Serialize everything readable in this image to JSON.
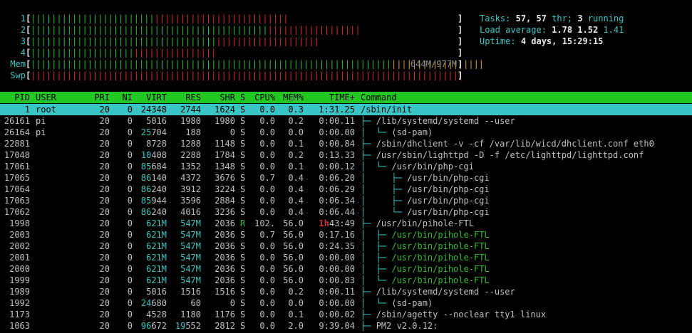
{
  "meters": {
    "cpu": [
      {
        "label": "1",
        "green": 24,
        "red": 26,
        "text": ""
      },
      {
        "label": "2",
        "green": 46,
        "red": 18,
        "text": ""
      },
      {
        "label": "3",
        "green": 36,
        "red": 20,
        "text": ""
      },
      {
        "label": "4",
        "green": 20,
        "red": 16,
        "text": ""
      }
    ],
    "mem": {
      "label": "Mem",
      "green": 70,
      "blue": 0,
      "orange": 18,
      "text": "644M/977M"
    },
    "swp": {
      "label": "Swp",
      "red": 84,
      "text": ""
    }
  },
  "stats": {
    "tasks_label": "Tasks:",
    "tasks_value": "57,",
    "thr_value": "57",
    "thr_label": "thr;",
    "running_value": "3",
    "running_label": "running",
    "load_label": "Load average:",
    "load1": "1.78",
    "load5": "1.52",
    "load15": "1.41",
    "uptime_label": "Uptime:",
    "uptime_value": "4 days, 15:29:15"
  },
  "columns": [
    "PID",
    "USER",
    "PRI",
    "NI",
    "VIRT",
    "RES",
    "SHR",
    "S",
    "CPU%",
    "MEM%",
    "TIME+",
    "Command"
  ],
  "processes": [
    {
      "pid": "1",
      "user": "root",
      "pri": "20",
      "ni": "0",
      "virt": "24348",
      "res": "2744",
      "shr": "1624",
      "s": "S",
      "cpu": "0.0",
      "mem": "0.3",
      "time": "1:31.25",
      "tree": "",
      "cmd": "/sbin/init",
      "selected": true
    },
    {
      "pid": "26161",
      "user": "pi",
      "pri": "20",
      "ni": "0",
      "virt": "5016",
      "res": "1980",
      "shr": "1980",
      "s": "S",
      "cpu": "0.0",
      "mem": "0.2",
      "time": "0:00.11",
      "tree": "├─ ",
      "cmd": "/lib/systemd/systemd --user"
    },
    {
      "pid": "26164",
      "user": "pi",
      "pri": "20",
      "ni": "0",
      "virt": "25704",
      "res": "188",
      "shr": "0",
      "s": "S",
      "cpu": "0.0",
      "mem": "0.0",
      "time": "0:00.00",
      "tree": "│  └─ ",
      "cmd": "(sd-pam)"
    },
    {
      "pid": "22881",
      "user": "",
      "pri": "20",
      "ni": "0",
      "virt": "8728",
      "res": "1288",
      "shr": "1148",
      "s": "S",
      "cpu": "0.0",
      "mem": "0.1",
      "time": "0:00.84",
      "tree": "├─ ",
      "cmd": "/sbin/dhclient -v -cf /var/lib/wicd/dhclient.conf eth0"
    },
    {
      "pid": "17048",
      "user": "",
      "pri": "20",
      "ni": "0",
      "virt": "10408",
      "res": "2288",
      "shr": "1784",
      "s": "S",
      "cpu": "0.0",
      "mem": "0.2",
      "time": "0:13.33",
      "tree": "├─ ",
      "cmd": "/usr/sbin/lighttpd -D -f /etc/lighttpd/lighttpd.conf"
    },
    {
      "pid": "17061",
      "user": "",
      "pri": "20",
      "ni": "0",
      "virt": "85684",
      "res": "1352",
      "shr": "1348",
      "s": "S",
      "cpu": "0.0",
      "mem": "0.1",
      "time": "0:00.12",
      "tree": "│  └─ ",
      "cmd": "/usr/bin/php-cgi"
    },
    {
      "pid": "17065",
      "user": "",
      "pri": "20",
      "ni": "0",
      "virt": "86140",
      "res": "4372",
      "shr": "3676",
      "s": "S",
      "cpu": "0.7",
      "mem": "0.4",
      "time": "0:06.20",
      "tree": "│     ├─ ",
      "cmd": "/usr/bin/php-cgi"
    },
    {
      "pid": "17064",
      "user": "",
      "pri": "20",
      "ni": "0",
      "virt": "86240",
      "res": "3912",
      "shr": "3224",
      "s": "S",
      "cpu": "0.0",
      "mem": "0.4",
      "time": "0:06.29",
      "tree": "│     ├─ ",
      "cmd": "/usr/bin/php-cgi"
    },
    {
      "pid": "17063",
      "user": "",
      "pri": "20",
      "ni": "0",
      "virt": "85944",
      "res": "3596",
      "shr": "2884",
      "s": "S",
      "cpu": "0.0",
      "mem": "0.4",
      "time": "0:06.34",
      "tree": "│     ├─ ",
      "cmd": "/usr/bin/php-cgi"
    },
    {
      "pid": "17062",
      "user": "",
      "pri": "20",
      "ni": "0",
      "virt": "86240",
      "res": "4016",
      "shr": "3236",
      "s": "S",
      "cpu": "0.0",
      "mem": "0.4",
      "time": "0:06.44",
      "tree": "│     └─ ",
      "cmd": "/usr/bin/php-cgi"
    },
    {
      "pid": "1998",
      "user": "",
      "pri": "20",
      "ni": "0",
      "virt": "621M",
      "res": "547M",
      "shr": "2036",
      "s": "R",
      "cpu": "102.",
      "mem": "56.0",
      "time_red": "1h",
      "time": "43:49",
      "tree": "├─ ",
      "cmd": "/usr/bin/pihole-FTL"
    },
    {
      "pid": "2003",
      "user": "",
      "pri": "20",
      "ni": "0",
      "virt": "621M",
      "res": "547M",
      "shr": "2036",
      "s": "S",
      "cpu": "0.7",
      "mem": "56.0",
      "time": "0:17.16",
      "tree": "│  ├─ ",
      "cmd": "/usr/bin/pihole-FTL",
      "thread": true
    },
    {
      "pid": "2002",
      "user": "",
      "pri": "20",
      "ni": "0",
      "virt": "621M",
      "res": "547M",
      "shr": "2036",
      "s": "S",
      "cpu": "0.0",
      "mem": "56.0",
      "time": "0:24.35",
      "tree": "│  ├─ ",
      "cmd": "/usr/bin/pihole-FTL",
      "thread": true
    },
    {
      "pid": "2001",
      "user": "",
      "pri": "20",
      "ni": "0",
      "virt": "621M",
      "res": "547M",
      "shr": "2036",
      "s": "S",
      "cpu": "0.0",
      "mem": "56.0",
      "time": "0:00.00",
      "tree": "│  ├─ ",
      "cmd": "/usr/bin/pihole-FTL",
      "thread": true
    },
    {
      "pid": "2000",
      "user": "",
      "pri": "20",
      "ni": "0",
      "virt": "621M",
      "res": "547M",
      "shr": "2036",
      "s": "S",
      "cpu": "0.0",
      "mem": "56.0",
      "time": "0:00.00",
      "tree": "│  ├─ ",
      "cmd": "/usr/bin/pihole-FTL",
      "thread": true
    },
    {
      "pid": "1999",
      "user": "",
      "pri": "20",
      "ni": "0",
      "virt": "621M",
      "res": "547M",
      "shr": "2036",
      "s": "S",
      "cpu": "0.0",
      "mem": "56.0",
      "time": "0:00.83",
      "tree": "│  └─ ",
      "cmd": "/usr/bin/pihole-FTL",
      "thread": true
    },
    {
      "pid": "1989",
      "user": "",
      "pri": "20",
      "ni": "0",
      "virt": "5016",
      "res": "1516",
      "shr": "1516",
      "s": "S",
      "cpu": "0.0",
      "mem": "0.2",
      "time": "0:00.11",
      "tree": "├─ ",
      "cmd": "/lib/systemd/systemd --user"
    },
    {
      "pid": "1992",
      "user": "",
      "pri": "20",
      "ni": "0",
      "virt": "24680",
      "res": "60",
      "shr": "0",
      "s": "S",
      "cpu": "0.0",
      "mem": "0.0",
      "time": "0:00.00",
      "tree": "│  └─ ",
      "cmd": "(sd-pam)"
    },
    {
      "pid": "1173",
      "user": "",
      "pri": "20",
      "ni": "0",
      "virt": "4528",
      "res": "1180",
      "shr": "1176",
      "s": "S",
      "cpu": "0.0",
      "mem": "0.1",
      "time": "0:00.02",
      "tree": "├─ ",
      "cmd": "/sbin/agetty --noclear tty1 linux"
    },
    {
      "pid": "1063",
      "user": "",
      "pri": "20",
      "ni": "0",
      "virt": "96672",
      "res": "19552",
      "shr": "2812",
      "s": "S",
      "cpu": "0.0",
      "mem": "2.0",
      "time": "9:39.04",
      "tree": "├─ ",
      "cmd": "PM2 v2.0.12:"
    }
  ],
  "colors": {
    "header_bg": "#22c822",
    "selected_bg": "#39c5c5",
    "accent": "#39c5c5",
    "bar_green": "#2dbd2d",
    "bar_red": "#d03030",
    "bar_orange": "#d8a020"
  }
}
